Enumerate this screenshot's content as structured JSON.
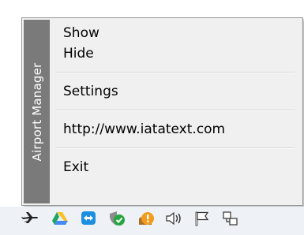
{
  "menu": {
    "band_label": "Airport Manager",
    "items": [
      {
        "label": "Show"
      },
      {
        "label": "Hide"
      },
      {
        "label": "Settings"
      },
      {
        "label": "http://www.iatatext.com"
      },
      {
        "label": "Exit"
      }
    ]
  },
  "tray": {
    "icons": [
      "airplane-icon",
      "google-drive-icon",
      "teamviewer-icon",
      "security-shield-icon",
      "warning-icon",
      "volume-icon",
      "action-center-flag-icon",
      "network-icon"
    ]
  }
}
